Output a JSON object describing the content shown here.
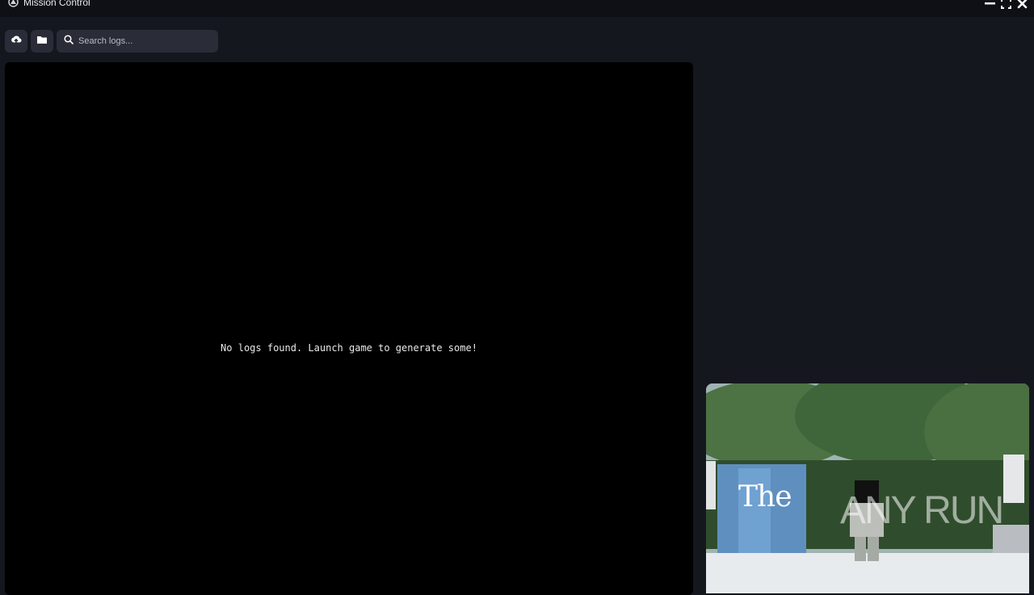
{
  "window": {
    "title": "Mission Control",
    "controls": {
      "minimize": "minimize-icon",
      "maximize": "maximize-icon",
      "close": "close-icon"
    }
  },
  "toolbar": {
    "upload_icon": "cloud-upload-icon",
    "folder_icon": "folder-icon",
    "search": {
      "placeholder": "Search logs...",
      "value": ""
    }
  },
  "logs": {
    "empty_message": "No logs found. Launch game to generate some!"
  },
  "preview": {
    "caption": "The",
    "watermark": "ANY RUN"
  }
}
